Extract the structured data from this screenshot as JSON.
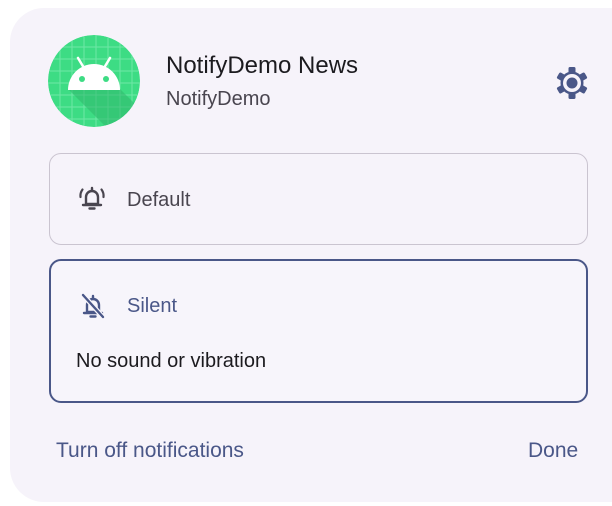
{
  "colors": {
    "card_background": "#f6f3fa",
    "accent": "#4a5788",
    "app_icon_green": "#3ddc84",
    "outline": "#cac4d0",
    "text_primary": "#1c1b1f",
    "text_secondary": "#49454f"
  },
  "header": {
    "app_icon": "android-app-icon",
    "title": "NotifyDemo News",
    "subtitle": "NotifyDemo",
    "settings_icon": "gear-icon"
  },
  "options": {
    "default": {
      "icon": "bell-ringing-icon",
      "label": "Default",
      "selected": false
    },
    "silent": {
      "icon": "bell-off-icon",
      "label": "Silent",
      "description": "No sound or vibration",
      "selected": true
    }
  },
  "footer": {
    "turn_off_label": "Turn off notifications",
    "done_label": "Done"
  }
}
